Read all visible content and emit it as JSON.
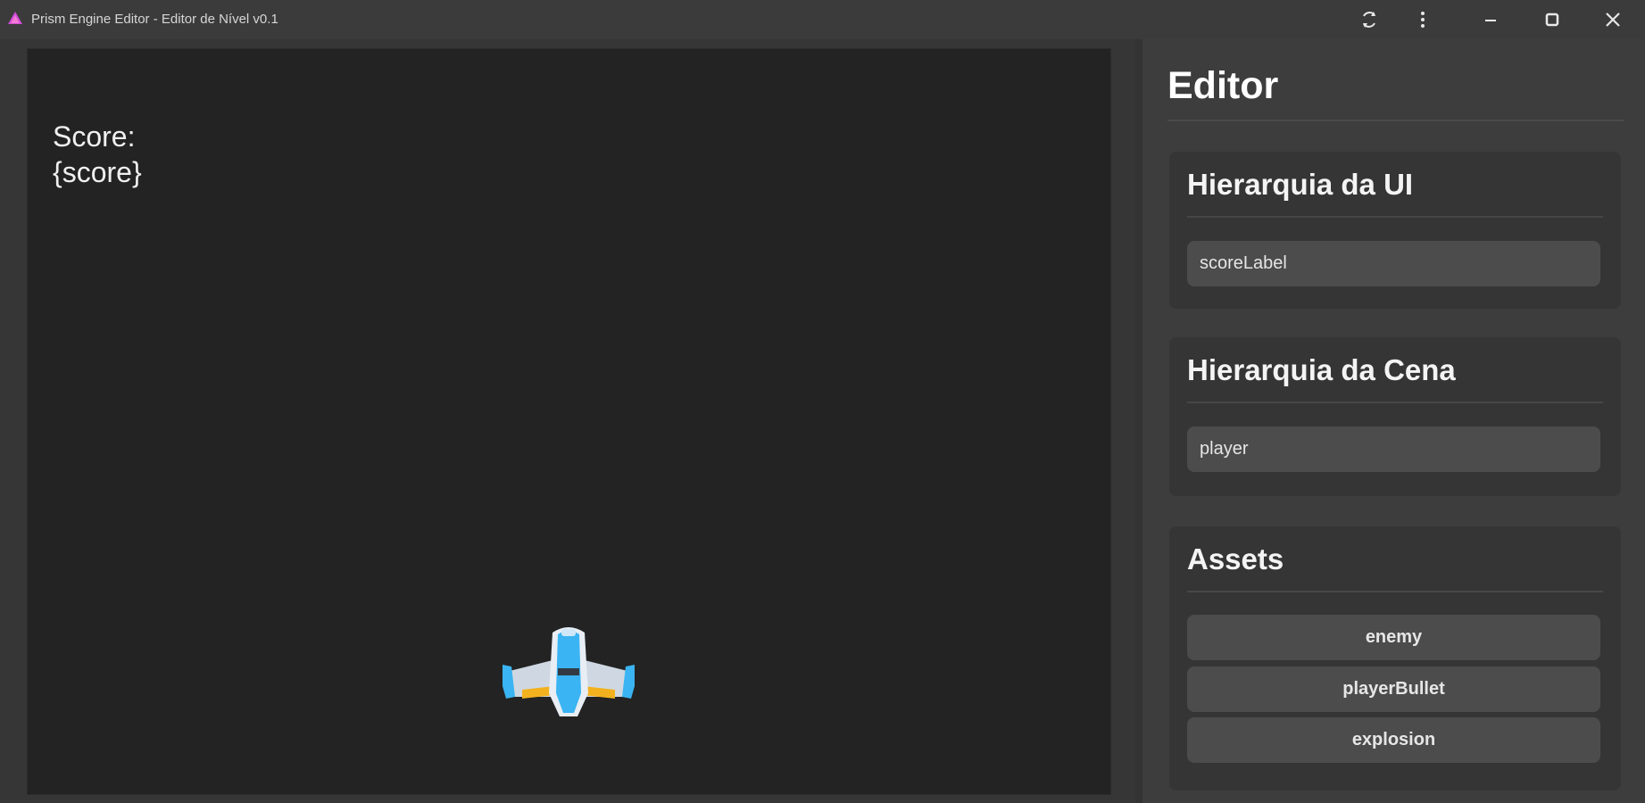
{
  "window": {
    "title": "Prism Engine Editor - Editor de Nível v0.1",
    "icon": "prism-logo-icon",
    "controls": [
      "reload-icon",
      "more-vertical-icon",
      "minimize-icon",
      "maximize-icon",
      "close-icon"
    ]
  },
  "game": {
    "score_label": "Score:\n{score}",
    "sprite": "spaceship"
  },
  "editor": {
    "title": "Editor",
    "ui_hierarchy": {
      "title": "Hierarquia da UI",
      "items": [
        "scoreLabel"
      ]
    },
    "scene_hierarchy": {
      "title": "Hierarquia da Cena",
      "items": [
        "player"
      ]
    },
    "assets": {
      "title": "Assets",
      "items": [
        "enemy",
        "playerBullet",
        "explosion"
      ]
    }
  },
  "colors": {
    "background": "#3a3a3a",
    "viewport": "#232323",
    "panel": "#3d3d3d",
    "card": "#353535",
    "button": "#4c4c4c",
    "ship_accent": "#3ab4f2"
  }
}
